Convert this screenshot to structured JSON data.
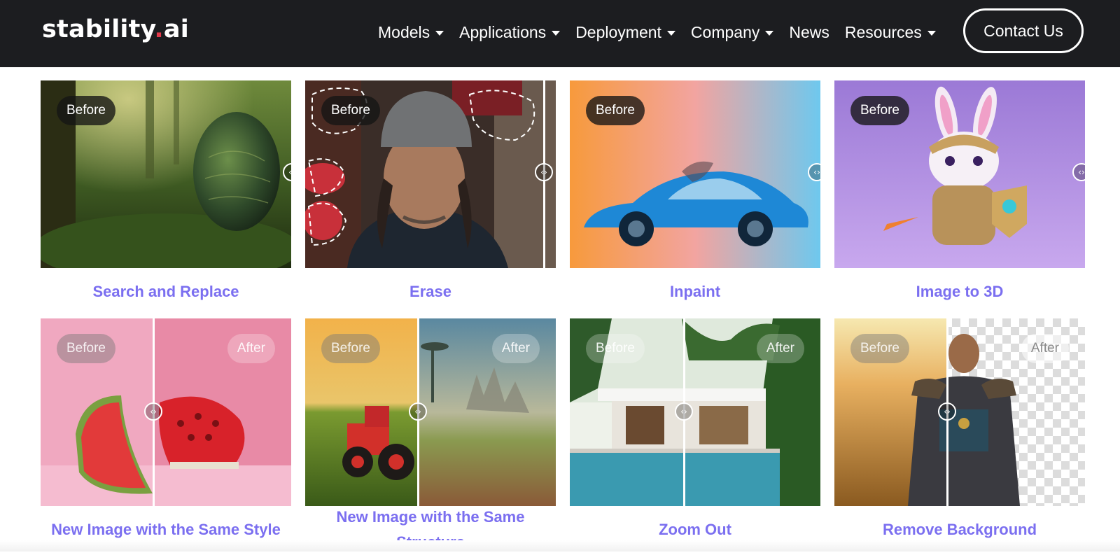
{
  "brand": {
    "name": "stability",
    "dot": ".",
    "suffix": "ai"
  },
  "nav": {
    "items": [
      {
        "label": "Models",
        "dropdown": true
      },
      {
        "label": "Applications",
        "dropdown": true
      },
      {
        "label": "Deployment",
        "dropdown": true
      },
      {
        "label": "Company",
        "dropdown": true
      },
      {
        "label": "News",
        "dropdown": false
      },
      {
        "label": "Resources",
        "dropdown": true
      }
    ],
    "contact": "Contact Us"
  },
  "labels": {
    "before": "Before",
    "after": "After",
    "handle": "‹›"
  },
  "cards": [
    {
      "title": "Search and Replace"
    },
    {
      "title": "Erase"
    },
    {
      "title": "Inpaint"
    },
    {
      "title": "Image to 3D"
    },
    {
      "title": "New Image with the Same Style"
    },
    {
      "title": "New Image with the Same Structure"
    },
    {
      "title": "Zoom Out"
    },
    {
      "title": "Remove Background"
    }
  ],
  "colors": {
    "nav_bg": "#1c1d20",
    "accent": "#7b6ff0",
    "logo_dot": "#e2394a"
  }
}
